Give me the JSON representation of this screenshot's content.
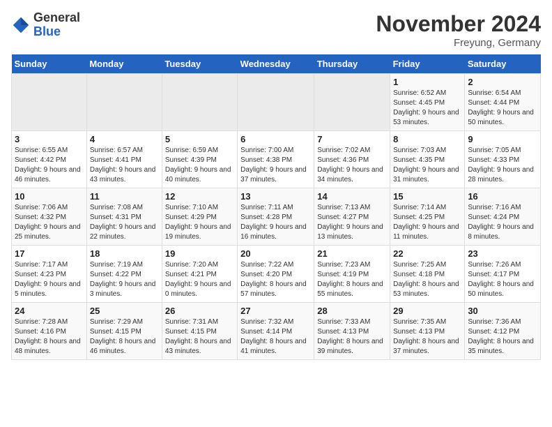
{
  "header": {
    "logo_general": "General",
    "logo_blue": "Blue",
    "month_title": "November 2024",
    "location": "Freyung, Germany"
  },
  "weekdays": [
    "Sunday",
    "Monday",
    "Tuesday",
    "Wednesday",
    "Thursday",
    "Friday",
    "Saturday"
  ],
  "weeks": [
    [
      {
        "day": "",
        "detail": ""
      },
      {
        "day": "",
        "detail": ""
      },
      {
        "day": "",
        "detail": ""
      },
      {
        "day": "",
        "detail": ""
      },
      {
        "day": "",
        "detail": ""
      },
      {
        "day": "1",
        "detail": "Sunrise: 6:52 AM\nSunset: 4:45 PM\nDaylight: 9 hours and 53 minutes."
      },
      {
        "day": "2",
        "detail": "Sunrise: 6:54 AM\nSunset: 4:44 PM\nDaylight: 9 hours and 50 minutes."
      }
    ],
    [
      {
        "day": "3",
        "detail": "Sunrise: 6:55 AM\nSunset: 4:42 PM\nDaylight: 9 hours and 46 minutes."
      },
      {
        "day": "4",
        "detail": "Sunrise: 6:57 AM\nSunset: 4:41 PM\nDaylight: 9 hours and 43 minutes."
      },
      {
        "day": "5",
        "detail": "Sunrise: 6:59 AM\nSunset: 4:39 PM\nDaylight: 9 hours and 40 minutes."
      },
      {
        "day": "6",
        "detail": "Sunrise: 7:00 AM\nSunset: 4:38 PM\nDaylight: 9 hours and 37 minutes."
      },
      {
        "day": "7",
        "detail": "Sunrise: 7:02 AM\nSunset: 4:36 PM\nDaylight: 9 hours and 34 minutes."
      },
      {
        "day": "8",
        "detail": "Sunrise: 7:03 AM\nSunset: 4:35 PM\nDaylight: 9 hours and 31 minutes."
      },
      {
        "day": "9",
        "detail": "Sunrise: 7:05 AM\nSunset: 4:33 PM\nDaylight: 9 hours and 28 minutes."
      }
    ],
    [
      {
        "day": "10",
        "detail": "Sunrise: 7:06 AM\nSunset: 4:32 PM\nDaylight: 9 hours and 25 minutes."
      },
      {
        "day": "11",
        "detail": "Sunrise: 7:08 AM\nSunset: 4:31 PM\nDaylight: 9 hours and 22 minutes."
      },
      {
        "day": "12",
        "detail": "Sunrise: 7:10 AM\nSunset: 4:29 PM\nDaylight: 9 hours and 19 minutes."
      },
      {
        "day": "13",
        "detail": "Sunrise: 7:11 AM\nSunset: 4:28 PM\nDaylight: 9 hours and 16 minutes."
      },
      {
        "day": "14",
        "detail": "Sunrise: 7:13 AM\nSunset: 4:27 PM\nDaylight: 9 hours and 13 minutes."
      },
      {
        "day": "15",
        "detail": "Sunrise: 7:14 AM\nSunset: 4:25 PM\nDaylight: 9 hours and 11 minutes."
      },
      {
        "day": "16",
        "detail": "Sunrise: 7:16 AM\nSunset: 4:24 PM\nDaylight: 9 hours and 8 minutes."
      }
    ],
    [
      {
        "day": "17",
        "detail": "Sunrise: 7:17 AM\nSunset: 4:23 PM\nDaylight: 9 hours and 5 minutes."
      },
      {
        "day": "18",
        "detail": "Sunrise: 7:19 AM\nSunset: 4:22 PM\nDaylight: 9 hours and 3 minutes."
      },
      {
        "day": "19",
        "detail": "Sunrise: 7:20 AM\nSunset: 4:21 PM\nDaylight: 9 hours and 0 minutes."
      },
      {
        "day": "20",
        "detail": "Sunrise: 7:22 AM\nSunset: 4:20 PM\nDaylight: 8 hours and 57 minutes."
      },
      {
        "day": "21",
        "detail": "Sunrise: 7:23 AM\nSunset: 4:19 PM\nDaylight: 8 hours and 55 minutes."
      },
      {
        "day": "22",
        "detail": "Sunrise: 7:25 AM\nSunset: 4:18 PM\nDaylight: 8 hours and 53 minutes."
      },
      {
        "day": "23",
        "detail": "Sunrise: 7:26 AM\nSunset: 4:17 PM\nDaylight: 8 hours and 50 minutes."
      }
    ],
    [
      {
        "day": "24",
        "detail": "Sunrise: 7:28 AM\nSunset: 4:16 PM\nDaylight: 8 hours and 48 minutes."
      },
      {
        "day": "25",
        "detail": "Sunrise: 7:29 AM\nSunset: 4:15 PM\nDaylight: 8 hours and 46 minutes."
      },
      {
        "day": "26",
        "detail": "Sunrise: 7:31 AM\nSunset: 4:15 PM\nDaylight: 8 hours and 43 minutes."
      },
      {
        "day": "27",
        "detail": "Sunrise: 7:32 AM\nSunset: 4:14 PM\nDaylight: 8 hours and 41 minutes."
      },
      {
        "day": "28",
        "detail": "Sunrise: 7:33 AM\nSunset: 4:13 PM\nDaylight: 8 hours and 39 minutes."
      },
      {
        "day": "29",
        "detail": "Sunrise: 7:35 AM\nSunset: 4:13 PM\nDaylight: 8 hours and 37 minutes."
      },
      {
        "day": "30",
        "detail": "Sunrise: 7:36 AM\nSunset: 4:12 PM\nDaylight: 8 hours and 35 minutes."
      }
    ]
  ]
}
